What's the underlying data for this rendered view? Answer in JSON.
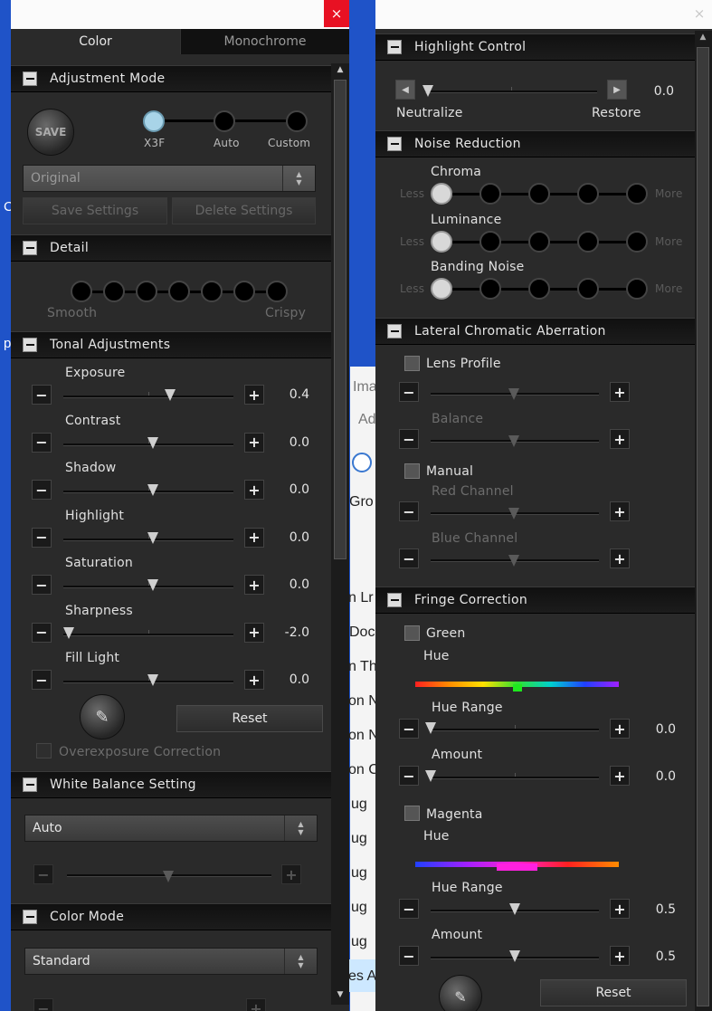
{
  "left_panel": {
    "close_symbol": "×",
    "tabs": [
      "Color",
      "Monochrome"
    ],
    "adjustment_mode": {
      "header": "Adjustment Mode",
      "save_label": "SAVE",
      "modes": [
        "X3F",
        "Auto",
        "Custom"
      ],
      "preset_value": "Original",
      "save_settings": "Save Settings",
      "delete_settings": "Delete Settings"
    },
    "detail": {
      "header": "Detail",
      "smooth": "Smooth",
      "crispy": "Crispy"
    },
    "tonal": {
      "header": "Tonal Adjustments",
      "sliders": [
        {
          "label": "Exposure",
          "value": "0.4"
        },
        {
          "label": "Contrast",
          "value": "0.0"
        },
        {
          "label": "Shadow",
          "value": "0.0"
        },
        {
          "label": "Highlight",
          "value": "0.0"
        },
        {
          "label": "Saturation",
          "value": "0.0"
        },
        {
          "label": "Sharpness",
          "value": "-2.0"
        },
        {
          "label": "Fill Light",
          "value": "0.0"
        }
      ],
      "reset": "Reset",
      "overexposure": "Overexposure Correction"
    },
    "white_balance": {
      "header": "White Balance Setting",
      "value": "Auto"
    },
    "color_mode": {
      "header": "Color Mode",
      "value": "Standard"
    }
  },
  "right_panel": {
    "close_symbol": "×",
    "highlight": {
      "header": "Highlight Control",
      "value": "0.0",
      "neutralize": "Neutralize",
      "restore": "Restore"
    },
    "noise": {
      "header": "Noise Reduction",
      "less": "Less",
      "more": "More",
      "rows": [
        "Chroma",
        "Luminance",
        "Banding Noise"
      ]
    },
    "lateral": {
      "header": "Lateral Chromatic Aberration",
      "lens_profile": "Lens Profile",
      "balance": "Balance",
      "manual": "Manual",
      "red": "Red Channel",
      "blue": "Blue Channel"
    },
    "fringe": {
      "header": "Fringe Correction",
      "green": "Green",
      "magenta": "Magenta",
      "hue": "Hue",
      "hue_range": "Hue Range",
      "amount": "Amount",
      "green_hue_range": "0.0",
      "green_amount": "0.0",
      "magenta_hue_range": "0.5",
      "magenta_amount": "0.5",
      "reset": "Reset"
    }
  },
  "background": {
    "left_edge": [
      "C",
      "p"
    ],
    "items": [
      "Ima",
      "Ad",
      "Gro",
      "n Lr",
      "Doc",
      "n Th",
      "on N",
      "on N",
      "on C",
      "ug",
      "ug",
      "ug",
      "ug",
      "ug",
      "es A"
    ]
  },
  "colors": {
    "desktop": "#1f53c8",
    "panel": "#2a2a2a",
    "close_red": "#e81123"
  }
}
